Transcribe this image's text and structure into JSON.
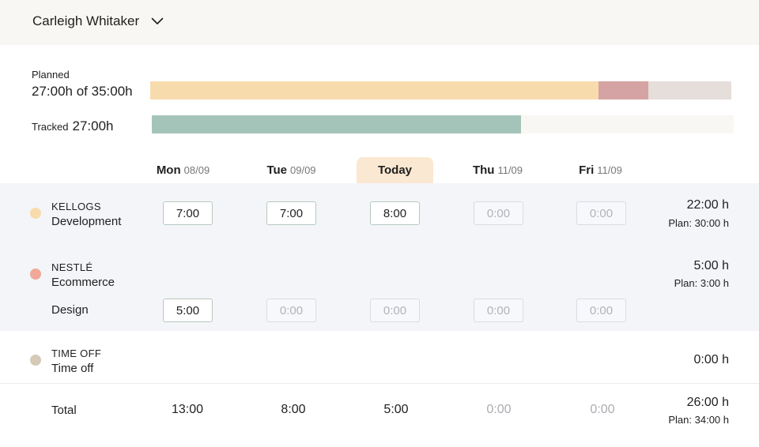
{
  "user": {
    "name": "Carleigh Whitaker",
    "chevron_icon": "chevron-down-icon"
  },
  "planned": {
    "label": "Planned",
    "value": "27:00h of 35:00h",
    "planned_hours": 27,
    "tracked_overlay_hours": 30,
    "capacity_hours": 35,
    "colors": {
      "planned": "#f8dbad",
      "over": "#d5a3a3",
      "remaining": "#e5dedb"
    }
  },
  "tracked": {
    "label": "Tracked",
    "value": "27:00h",
    "fraction": 0.634,
    "color": "#a5c4b9"
  },
  "days": [
    {
      "name": "Mon",
      "date": "08/09"
    },
    {
      "name": "Tue",
      "date": "09/09"
    },
    {
      "name": "Today",
      "date": ""
    },
    {
      "name": "Thu",
      "date": "11/09"
    },
    {
      "name": "Fri",
      "date": "11/09"
    }
  ],
  "rows": {
    "kellogs": {
      "client": "KELLOGS",
      "dot_color": "#f8dbad",
      "project": "Development",
      "cells": [
        "7:00",
        "7:00",
        "8:00",
        "0:00",
        "0:00"
      ],
      "sum": "22:00 h",
      "plan": "Plan: 30:00 h"
    },
    "nestle": {
      "client": "NESTLÉ",
      "dot_color": "#f0a898",
      "project": "Ecommerce",
      "sum": "5:00 h",
      "plan": "Plan: 3:00 h",
      "sub_project": "Design",
      "cells": [
        "5:00",
        "0:00",
        "0:00",
        "0:00",
        "0:00"
      ]
    },
    "timeoff": {
      "client": "TIME OFF",
      "dot_color": "#d6c9b8",
      "project": "Time off",
      "sum": "0:00 h"
    }
  },
  "total": {
    "label": "Total",
    "values": [
      "13:00",
      "8:00",
      "5:00",
      "0:00",
      "0:00"
    ],
    "sum": "26:00 h",
    "plan": "Plan: 34:00 h"
  }
}
